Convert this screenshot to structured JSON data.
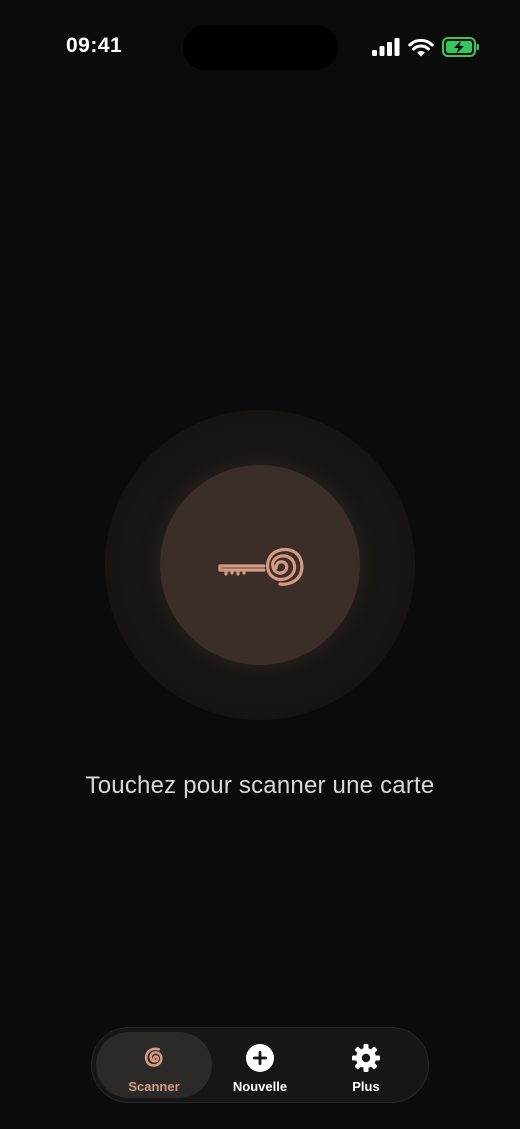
{
  "status_bar": {
    "time": "09:41",
    "icons": [
      "cellular-signal-icon",
      "wifi-icon",
      "battery-charging-icon"
    ],
    "battery_color": "#34c759"
  },
  "scan": {
    "prompt": "Touchez pour scanner une carte",
    "icon": "key-spiral-icon",
    "accent_color": "#d49a82"
  },
  "tab_bar": {
    "tabs": [
      {
        "label": "Scanner",
        "icon": "spiral-icon",
        "active": true
      },
      {
        "label": "Nouvelle",
        "icon": "plus-circle-icon",
        "active": false
      },
      {
        "label": "Plus",
        "icon": "gear-icon",
        "active": false
      }
    ]
  }
}
